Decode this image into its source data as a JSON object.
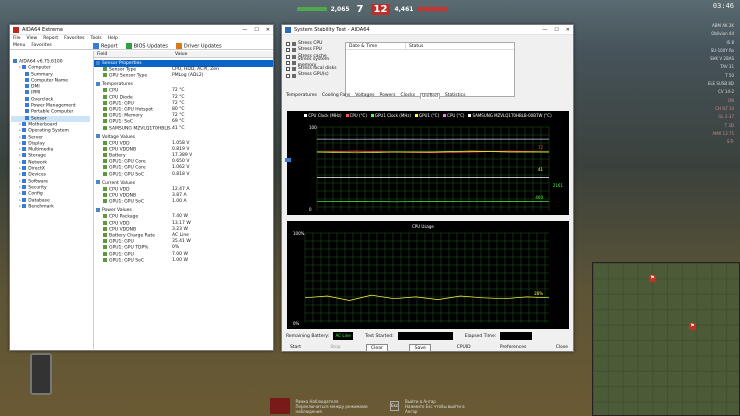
{
  "hud": {
    "ally_score": "2,065",
    "ally_count": "7",
    "enemy_count": "12",
    "enemy_score": "4,461",
    "clock": "03:46"
  },
  "roster": [
    "ABM AK 2K",
    "Oblivion 44",
    "IS 8",
    "SU-100Y Ro",
    "SHK V 2BAS",
    "TAV 31",
    "T 50",
    "ELE SUSB 8D",
    "CV 14-2",
    "ON",
    "CH ILT 10",
    "GL 2-37",
    "T 3D",
    "AMX 13 75",
    "S-Tr"
  ],
  "aida": {
    "title": "AIDA64 Extreme",
    "menu": [
      "File",
      "View",
      "Report",
      "Favorites",
      "Tools",
      "Help"
    ],
    "tabs": [
      "Menu",
      "Favorites"
    ],
    "toolbar": [
      "Report",
      "BIOS Updates",
      "Driver Updates"
    ],
    "tree": [
      {
        "label": "AIDA64 v6.75.6100",
        "indent": 0
      },
      {
        "label": "Computer",
        "indent": 1
      },
      {
        "label": "Summary",
        "indent": 2
      },
      {
        "label": "Computer Name",
        "indent": 2
      },
      {
        "label": "DMI",
        "indent": 2
      },
      {
        "label": "IPMI",
        "indent": 2
      },
      {
        "label": "Overclock",
        "indent": 2
      },
      {
        "label": "Power Management",
        "indent": 2
      },
      {
        "label": "Portable Computer",
        "indent": 2
      },
      {
        "label": "Sensor",
        "indent": 2
      },
      {
        "label": "Motherboard",
        "indent": 1
      },
      {
        "label": "Operating System",
        "indent": 1
      },
      {
        "label": "Server",
        "indent": 1
      },
      {
        "label": "Display",
        "indent": 1
      },
      {
        "label": "Multimedia",
        "indent": 1
      },
      {
        "label": "Storage",
        "indent": 1
      },
      {
        "label": "Network",
        "indent": 1
      },
      {
        "label": "DirectX",
        "indent": 1
      },
      {
        "label": "Devices",
        "indent": 1
      },
      {
        "label": "Software",
        "indent": 1
      },
      {
        "label": "Security",
        "indent": 1
      },
      {
        "label": "Config",
        "indent": 1
      },
      {
        "label": "Database",
        "indent": 1
      },
      {
        "label": "Benchmark",
        "indent": 1
      }
    ],
    "columns": [
      "Field",
      "Value"
    ],
    "sections": [
      {
        "title": "Sensor Properties",
        "rows": [
          [
            "Sensor Type",
            "CPU, HDD, ACPI, Zen"
          ],
          [
            "GPU Sensor Type",
            "PMLog (ADL2)"
          ]
        ]
      },
      {
        "title": "Temperatures",
        "rows": [
          [
            "CPU",
            "72 °C"
          ],
          [
            "CPU Diode",
            "72 °C"
          ],
          [
            "GPU1: GPU",
            "72 °C"
          ],
          [
            "GPU1: GPU Hotspot",
            "80 °C"
          ],
          [
            "GPU1: Memory",
            "72 °C"
          ],
          [
            "GPU1: SoC",
            "69 °C"
          ],
          [
            "SAMSUNG MZVLQ1T0HBLB-...",
            "41 °C"
          ]
        ]
      },
      {
        "title": "Voltage Values",
        "rows": [
          [
            "CPU VDD",
            "1.058 V"
          ],
          [
            "CPU VDDNB",
            "0.819 V"
          ],
          [
            "Battery",
            "17.389 V"
          ],
          [
            "GPU1: GPU Core",
            "0.650 V"
          ],
          [
            "GPU1: GPU Core",
            "1.062 V"
          ],
          [
            "GPU1: GPU SoC",
            "0.818 V"
          ]
        ]
      },
      {
        "title": "Current Values",
        "rows": [
          [
            "CPU VDD",
            "12.47 A"
          ],
          [
            "CPU VDDNB",
            "3.87 A"
          ],
          [
            "GPU1: GPU SoC",
            "1.00 A"
          ]
        ]
      },
      {
        "title": "Power Values",
        "rows": [
          [
            "CPU Package",
            "7.40 W"
          ],
          [
            "CPU VDD",
            "13.17 W"
          ],
          [
            "CPU VDDNB",
            "3.23 W"
          ],
          [
            "Battery Charge Rate",
            "AC Line"
          ],
          [
            "GPU1: GPU",
            "35.41 W"
          ],
          [
            "GPU1: GPU TDP%",
            "0%"
          ],
          [
            "GPU1: GPU",
            "7.00 W"
          ],
          [
            "GPU1: GPU SoC",
            "1.00 W"
          ]
        ]
      }
    ]
  },
  "sst": {
    "title": "System Stability Test - AIDA64",
    "stress": [
      "Stress CPU",
      "Stress FPU",
      "Stress cache",
      "Stress system memory",
      "Stress local disks",
      "Stress GPU(s)"
    ],
    "table_cols": [
      "Date & Time",
      "Status"
    ],
    "tabs": [
      "Temperatures",
      "Cooling Fans",
      "Voltages",
      "Powers",
      "Clocks",
      "Unified",
      "Statistics"
    ],
    "active_tab": "Unified",
    "legend": [
      "CPU Clock (MHz)",
      "CPU (°C)",
      "GPU1 Clock (MHz)",
      "GPU1 (°C)",
      "CPU (°C)",
      "SAMSUNG MZVLQ1T0HBLB-00B7W (°C)"
    ],
    "legend_colors": [
      "#ffffff",
      "#ff5050",
      "#50ff50",
      "#ffff40",
      "#ff70ff",
      "#ffffff"
    ],
    "g1_top": "100",
    "g1_bottom": "0",
    "g1_right": [
      "72",
      "41",
      "2161",
      "400"
    ],
    "g2_title": "CPU Usage",
    "g2_top": "100%",
    "g2_bottom": "0%",
    "g2_right": "28%",
    "remaining_label": "Remaining Battery:",
    "remaining_value": "AC Line",
    "test_started_label": "Test Started:",
    "elapsed_label": "Elapsed Time:",
    "buttons": [
      "Start",
      "Stop",
      "Clear",
      "Save",
      "CPUID",
      "Preferences",
      "Close"
    ]
  },
  "bottom": {
    "left_title": "Рамка Наблюдателя",
    "left_sub": "Переключиться между режимами наблюдения",
    "key": "Esc",
    "right_title": "Выйти в Ангар",
    "right_sub": "Нажмите Esc чтобы выйти в Ангар"
  },
  "chart_data": [
    {
      "type": "line",
      "title": "",
      "xlabel": "",
      "ylabel": "",
      "ylim": [
        0,
        100
      ],
      "series": [
        {
          "name": "CPU Clock (MHz)",
          "values": [
            2161,
            2150,
            2170,
            2140,
            2160,
            2155,
            2161
          ]
        },
        {
          "name": "CPU (°C)",
          "values": [
            72,
            73,
            72,
            71,
            72,
            73,
            72
          ]
        },
        {
          "name": "GPU1 Clock (MHz)",
          "values": [
            400,
            410,
            395,
            405,
            400,
            402,
            400
          ]
        },
        {
          "name": "GPU1 (°C)",
          "values": [
            72,
            71,
            72,
            72,
            73,
            72,
            72
          ]
        },
        {
          "name": "SAMSUNG MZVLQ1T0HBLB-00B7W (°C)",
          "values": [
            41,
            41,
            41,
            41,
            41,
            41,
            41
          ]
        }
      ]
    },
    {
      "type": "line",
      "title": "CPU Usage",
      "ylim": [
        0,
        100
      ],
      "series": [
        {
          "name": "CPU Usage",
          "values": [
            28,
            30,
            25,
            31,
            27,
            29,
            26,
            30,
            28,
            27,
            29,
            28
          ]
        }
      ]
    }
  ]
}
